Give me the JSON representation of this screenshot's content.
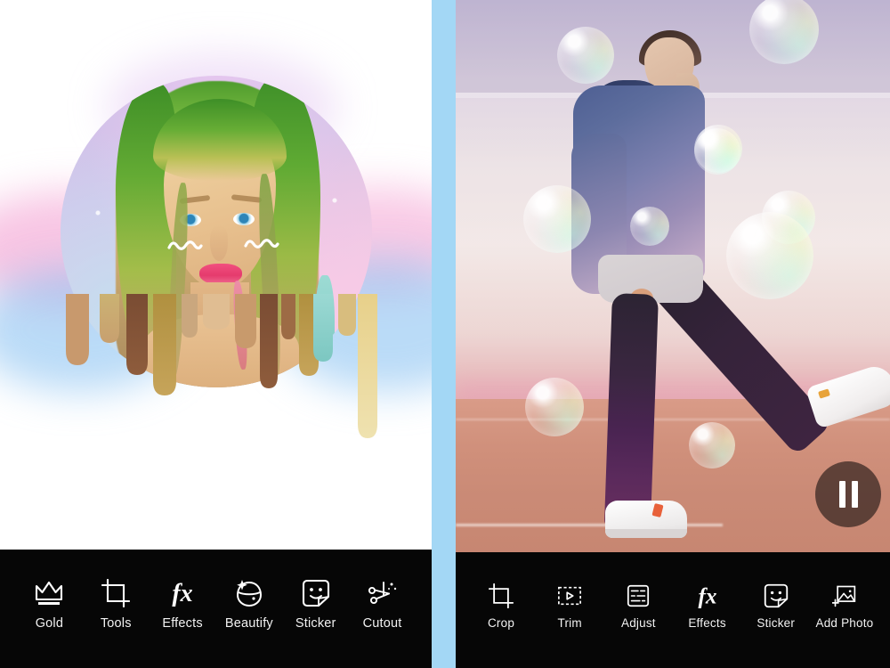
{
  "app": {
    "layout": "two-panel side-by-side photo editor screenshots",
    "divider_color": "#a3d7f5",
    "toolbar_bg": "#060606",
    "toolbar_label_color": "#f2f2f2"
  },
  "left_panel": {
    "canvas": {
      "name": "portrait-drip-artwork",
      "background": "#ffffff",
      "subject": "female portrait with green and blonde hair",
      "frame_shape": "circle",
      "frame_colors": [
        "#cdbfe8",
        "#e7c8e4",
        "#f2cfe2",
        "#dfe9f4"
      ],
      "overlays": [
        "pink-cloud",
        "blue-cloud",
        "white-sparkles",
        "cheek-squiggles",
        "paint-drip"
      ]
    },
    "toolbar": {
      "items": [
        {
          "label": "Gold",
          "icon": "crown-icon"
        },
        {
          "label": "Tools",
          "icon": "crop-tools-icon"
        },
        {
          "label": "Effects",
          "icon": "fx-icon"
        },
        {
          "label": "Beautify",
          "icon": "face-sparkle-icon"
        },
        {
          "label": "Sticker",
          "icon": "sticker-smiley-icon"
        },
        {
          "label": "Cutout",
          "icon": "scissors-sparkle-icon"
        }
      ]
    }
  },
  "right_panel": {
    "canvas": {
      "name": "bubble-video-frame",
      "subject": "man in blue jacket kicking, pastel gradient filter",
      "background_colors": [
        "#c6badc",
        "#f1e9e4",
        "#d79a84"
      ],
      "overlays": [
        "soap-bubbles",
        "pastel-gradient-filter"
      ],
      "bubble_count": 9
    },
    "playback": {
      "state": "playing",
      "control_label": "pause",
      "icon": "pause-icon",
      "button_fill": "rgba(28,20,18,0.62)"
    },
    "toolbar": {
      "items": [
        {
          "label": "Crop",
          "icon": "crop-icon"
        },
        {
          "label": "Trim",
          "icon": "film-trim-icon"
        },
        {
          "label": "Adjust",
          "icon": "sliders-panel-icon"
        },
        {
          "label": "Effects",
          "icon": "fx-icon"
        },
        {
          "label": "Sticker",
          "icon": "sticker-smiley-icon"
        },
        {
          "label": "Add Photo",
          "icon": "add-photo-icon"
        }
      ]
    }
  }
}
